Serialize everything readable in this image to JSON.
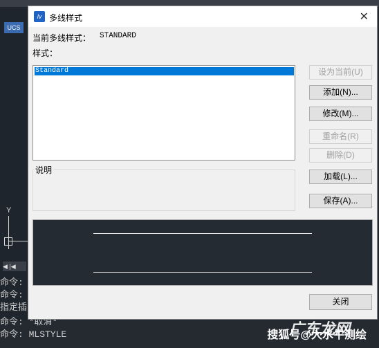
{
  "dialog": {
    "title": "多线样式",
    "current_style_label": "当前多线样式：",
    "current_style_value": "STANDARD",
    "styles_label": "样式：",
    "styles": [
      "Standard"
    ],
    "description_label": "说明",
    "buttons": {
      "set_current": "设为当前(U)",
      "add": "添加(N)...",
      "modify": "修改(M)...",
      "rename": "重命名(R)",
      "delete": "删除(D)",
      "load": "加载(L)...",
      "save": "保存(A)..."
    },
    "close": "关闭"
  },
  "background": {
    "command_history": [
      "命令:",
      "命令:",
      "指定插",
      "命令:"
    ],
    "prompt_partial": "命令: *取消*",
    "command_line": "命令: MLSTYLE",
    "ucs_label": "UCS",
    "axis_label": "Y",
    "watermark_big": "广东龙网",
    "watermark_small": "搜狐号@大水牛测绘"
  },
  "colors": {
    "selection": "#0078d7",
    "preview_bg": "#252b33",
    "dialog_bg": "#f0f0f0"
  }
}
